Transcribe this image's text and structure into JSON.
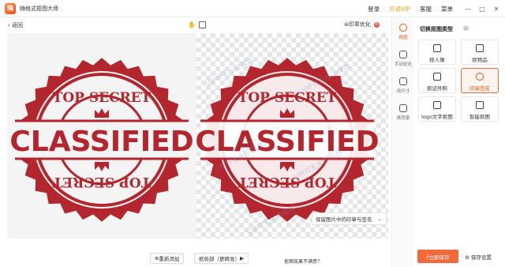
{
  "app": {
    "title": "嗨格式抠图大师",
    "logo_char": "嗨"
  },
  "titlebar": {
    "login": "登录",
    "vip": "开通VIP",
    "service": "客服",
    "menu": "菜单",
    "minimize": "—",
    "maximize": "□",
    "close": "✕"
  },
  "toolbar": {
    "back": "返回",
    "optimize": "印章优化"
  },
  "stamp": {
    "top_text": "TOP SECRET",
    "center_text": "CLASSIFIED",
    "bottom_text": "TOP SECRET"
  },
  "watermark": "VIP可无水印保存",
  "keep_dropdown": {
    "label": "保留图片中的印章与签名"
  },
  "bottom": {
    "re_add": "重新添加",
    "local": "抠局部（更精准）",
    "hint": "抠图效果不满意？"
  },
  "tools": [
    {
      "label": "抠图"
    },
    {
      "label": "手动优化"
    },
    {
      "label": "改尺寸"
    },
    {
      "label": "换背景"
    }
  ],
  "panel": {
    "title": "切换抠图类型",
    "types": [
      {
        "label": "抠人像"
      },
      {
        "label": "抠物品"
      },
      {
        "label": "抠证件照"
      },
      {
        "label": "印章签名"
      },
      {
        "label": "logo文字抠图"
      },
      {
        "label": "智能抠图"
      }
    ],
    "save": "立即保存",
    "save_settings": "保存设置"
  },
  "colors": {
    "accent": "#f26a3a",
    "stamp": "#b3262d",
    "vip": "#f5a623"
  }
}
